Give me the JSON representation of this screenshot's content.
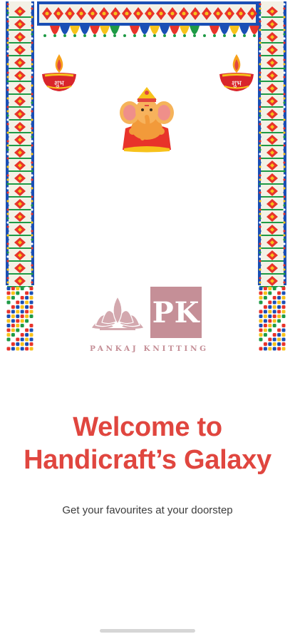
{
  "logo": {
    "monogram": "PK",
    "brand_name": "PANKAJ KNITTING"
  },
  "decorations": {
    "diya_text": "शुभ",
    "icons": [
      "toran",
      "diya",
      "ganesha",
      "lotus"
    ]
  },
  "welcome": {
    "line1": "Welcome to",
    "line2": "Handicraft’s Galaxy",
    "tagline": "Get your favourites at your doorstep"
  },
  "colors": {
    "accent_red": "#e0463f",
    "brand_pink": "#c58f97",
    "tagline_gray": "#3c3c3c",
    "background": "#ffffff"
  }
}
